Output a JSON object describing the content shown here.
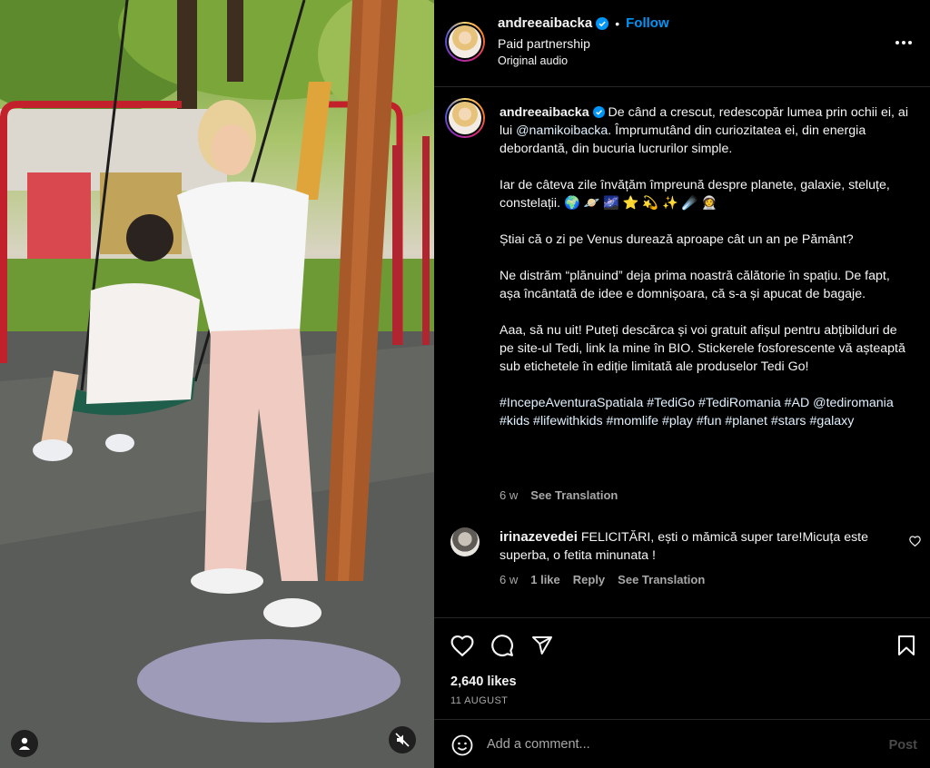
{
  "media": {
    "user_icon": "user-circle-icon",
    "mute_icon": "muted-speaker-icon"
  },
  "header": {
    "username": "andreeaibacka",
    "separator": "•",
    "follow_label": "Follow",
    "subtitle": "Paid partnership",
    "audio": "Original audio",
    "more_icon": "more-horizontal-icon"
  },
  "caption": {
    "username": "andreeaibacka",
    "para1_a": "De când a crescut, redescopăr lumea prin ochii ei, ai lui ",
    "mention1": "@namikoibacka",
    "para1_b": ". Împrumutând din curiozitatea ei, din energia debordantă, din bucuria lucrurilor simple.",
    "para2": "Iar de câteva zile învățăm împreună despre planete, galaxie, steluțe, constelații. 🌍 🪐 🌌 ⭐️ 💫 ✨ ☄️ 👩‍🚀",
    "para3": "Știai că o zi pe Venus durează aproape cât un an pe Pământ?",
    "para4": "Ne distrăm “plănuind” deja prima noastră călătorie în spațiu. De fapt, așa încântată de idee e domnișoara, că s-a și apucat de bagaje.",
    "para5": "Aaa, să nu uit! Puteți descărca și voi gratuit afișul pentru abțibilduri de pe site-ul Tedi, link la mine în BIO. Stickerele fosforescente vă așteaptă sub etichetele în ediție limitată ale produselor Tedi Go!",
    "hashtags": "#IncepeAventuraSpatiala #TediGo #TediRomania #AD @tediromania #kids #lifewithkids #momlife #play #fun #planet #stars #galaxy",
    "time": "6 w",
    "see_translation": "See Translation"
  },
  "reply": {
    "username": "irinazevedei",
    "text": "FELICITĂRI, ești o mămică super tare!Micuța este superba, o fetita minunata !",
    "time": "6 w",
    "likes": "1 like",
    "reply_label": "Reply",
    "see_translation": "See Translation"
  },
  "actions": {
    "likes": "2,640 likes",
    "date": "11 AUGUST"
  },
  "add_comment": {
    "placeholder": "Add a comment...",
    "post_label": "Post"
  },
  "colors": {
    "accent": "#0095f6",
    "background": "#000000",
    "muted_text": "#a8a8a8",
    "border": "#262626"
  }
}
